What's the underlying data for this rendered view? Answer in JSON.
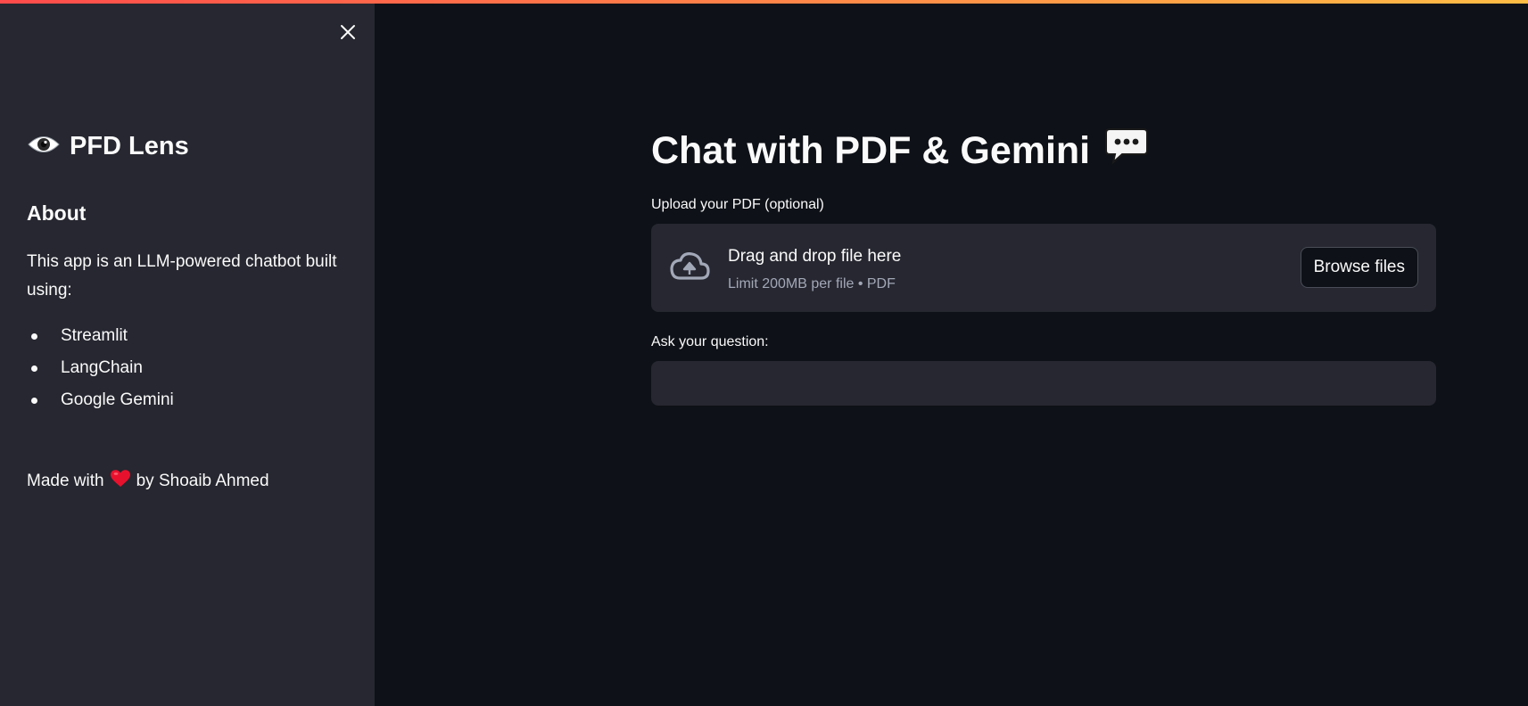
{
  "sidebar": {
    "close_icon": "close-icon",
    "brand": {
      "icon": "eye-icon",
      "title": "PFD Lens"
    },
    "about_heading": "About",
    "about_text": "This app is an LLM-powered chatbot built using:",
    "tech_list": [
      "Streamlit",
      "LangChain",
      "Google Gemini"
    ],
    "footer": {
      "prefix": "Made with",
      "icon": "heart-icon",
      "suffix": "by Shoaib Ahmed"
    }
  },
  "main": {
    "title": "Chat with PDF & Gemini",
    "title_icon": "speech-bubble-icon",
    "upload": {
      "label": "Upload your PDF (optional)",
      "dropzone_title": "Drag and drop file here",
      "dropzone_limit": "Limit 200MB per file • PDF",
      "browse_label": "Browse files",
      "icon": "cloud-upload-icon"
    },
    "question": {
      "label": "Ask your question:",
      "value": ""
    }
  },
  "colors": {
    "main_bg": "#0e1117",
    "sidebar_bg": "#262730",
    "text": "#fafafa",
    "muted_text": "#a3a8b8",
    "accent_gradient_start": "#ff4b4b",
    "accent_gradient_end": "#ffbd45",
    "heart": "#e8112d"
  }
}
